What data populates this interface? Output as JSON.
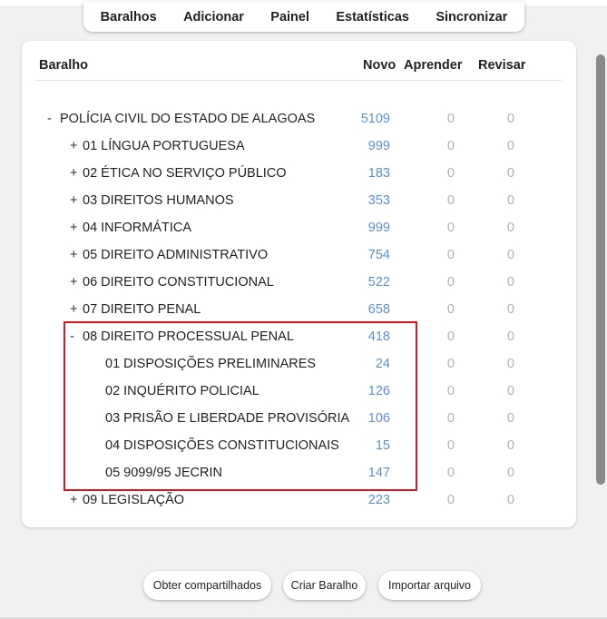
{
  "toolbar": {
    "items": [
      "Baralhos",
      "Adicionar",
      "Painel",
      "Estatísticas",
      "Sincronizar"
    ]
  },
  "table": {
    "headers": {
      "deck": "Baralho",
      "new": "Novo",
      "learn": "Aprender",
      "review": "Revisar"
    },
    "rows": [
      {
        "toggle": "-",
        "name": "POLÍCIA CIVIL DO ESTADO DE ALAGOAS",
        "new": "5109",
        "learn": "0",
        "review": "0"
      },
      {
        "toggle": "+",
        "name": "01 LÍNGUA PORTUGUESA",
        "new": "999",
        "learn": "0",
        "review": "0"
      },
      {
        "toggle": "+",
        "name": "02 ÉTICA NO SERVIÇO PÚBLICO",
        "new": "183",
        "learn": "0",
        "review": "0"
      },
      {
        "toggle": "+",
        "name": "03 DIREITOS HUMANOS",
        "new": "353",
        "learn": "0",
        "review": "0"
      },
      {
        "toggle": "+",
        "name": "04 INFORMÁTICA",
        "new": "999",
        "learn": "0",
        "review": "0"
      },
      {
        "toggle": "+",
        "name": "05 DIREITO ADMINISTRATIVO",
        "new": "754",
        "learn": "0",
        "review": "0"
      },
      {
        "toggle": "+",
        "name": "06 DIREITO CONSTITUCIONAL",
        "new": "522",
        "learn": "0",
        "review": "0"
      },
      {
        "toggle": "+",
        "name": "07 DIREITO PENAL",
        "new": "658",
        "learn": "0",
        "review": "0"
      },
      {
        "toggle": "-",
        "name": "08 DIREITO PROCESSUAL PENAL",
        "new": "418",
        "learn": "0",
        "review": "0"
      },
      {
        "toggle": "",
        "name": "01 DISPOSIÇÕES PRELIMINARES",
        "new": "24",
        "learn": "0",
        "review": "0"
      },
      {
        "toggle": "",
        "name": "02 INQUÉRITO POLICIAL",
        "new": "126",
        "learn": "0",
        "review": "0"
      },
      {
        "toggle": "",
        "name": "03 PRISÃO E LIBERDADE PROVISÓRIA",
        "new": "106",
        "learn": "0",
        "review": "0"
      },
      {
        "toggle": "",
        "name": "04 DISPOSIÇÕES CONSTITUCIONAIS",
        "new": "15",
        "learn": "0",
        "review": "0"
      },
      {
        "toggle": "",
        "name": "05 9099/95 JECRIN",
        "new": "147",
        "learn": "0",
        "review": "0"
      },
      {
        "toggle": "+",
        "name": "09 LEGISLAÇÃO",
        "new": "223",
        "learn": "0",
        "review": "0"
      }
    ]
  },
  "buttons": {
    "shared": "Obter compartilhados",
    "create": "Criar Baralho",
    "import": "Importar arquivo"
  },
  "colors": {
    "new_count": "#5b8fd6",
    "zero_count": "#b0b0b0",
    "highlight": "#d8141c"
  }
}
